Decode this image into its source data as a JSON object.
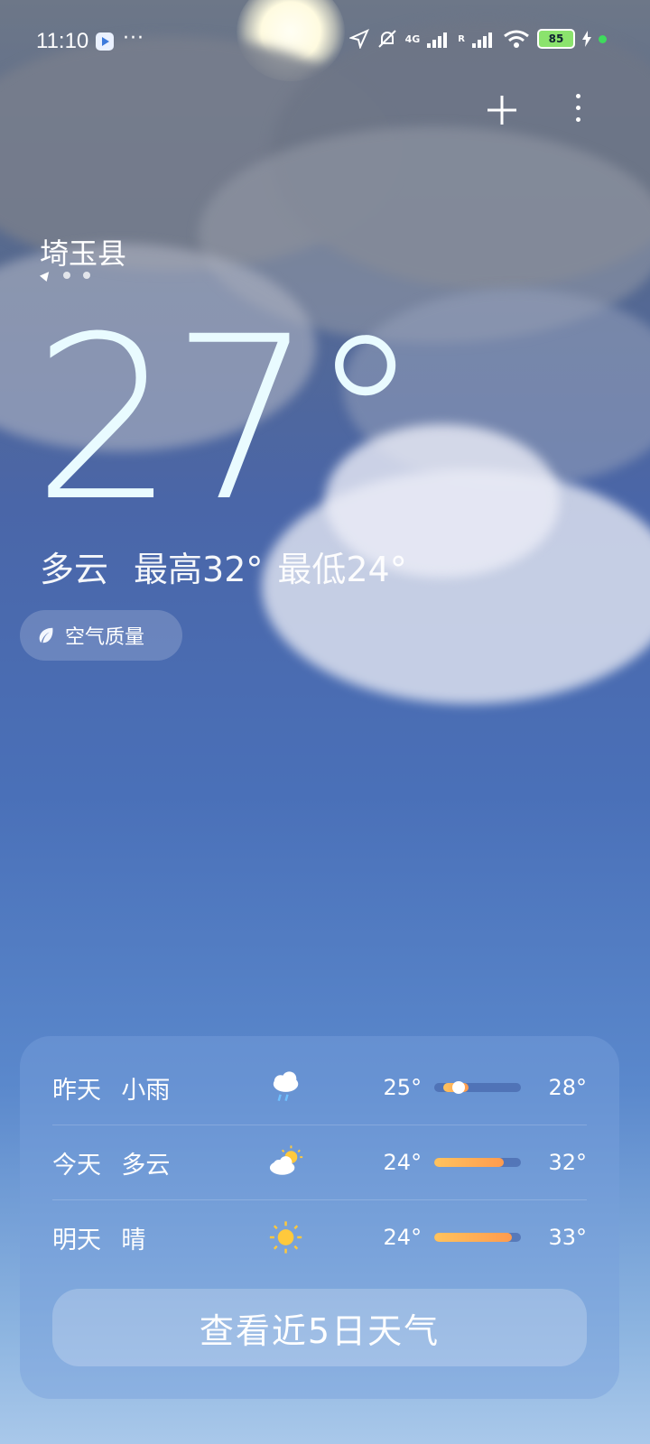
{
  "status_bar": {
    "time": "11:10",
    "more": "···",
    "network_label": "4G",
    "roaming_label": "R",
    "battery": "85"
  },
  "location": {
    "name": "埼玉县"
  },
  "current": {
    "temperature": "27°",
    "condition": "多云",
    "high": "最高32°",
    "low": "最低24°"
  },
  "aqi_chip": {
    "label": "空气质量"
  },
  "forecast": {
    "rows": [
      {
        "day": "昨天",
        "condition": "小雨",
        "icon": "rain-cloud-icon",
        "low": "25°",
        "high": "28°",
        "range_start": 0.1,
        "range_end": 0.4
      },
      {
        "day": "今天",
        "condition": "多云",
        "icon": "partly-cloudy-icon",
        "low": "24°",
        "high": "32°",
        "range_start": 0.0,
        "range_end": 0.8
      },
      {
        "day": "明天",
        "condition": "晴",
        "icon": "sun-icon",
        "low": "24°",
        "high": "33°",
        "range_start": 0.0,
        "range_end": 0.9
      }
    ],
    "button_label": "查看近5日天气"
  },
  "colors": {
    "bar_fill_start": "#ffc35e",
    "bar_fill_end": "#ff9b4e",
    "temperature_text": "#e9fbff"
  }
}
